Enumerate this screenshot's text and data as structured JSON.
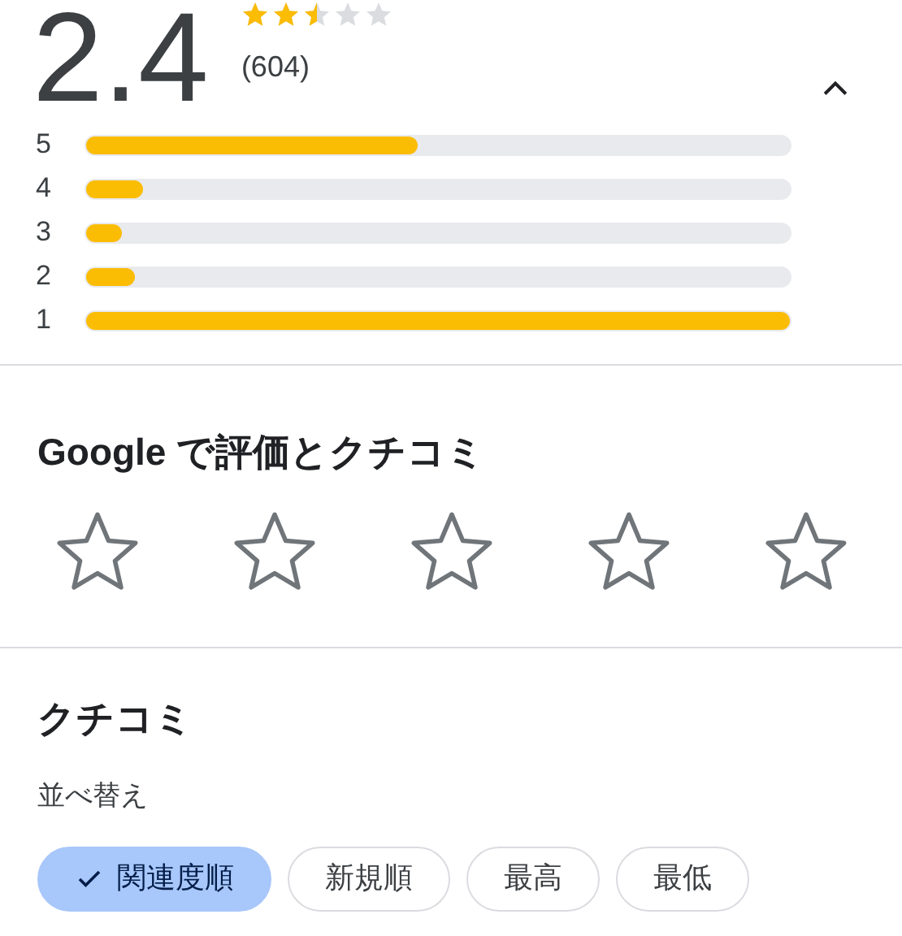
{
  "summary": {
    "score": "2.4",
    "stars": 2.5,
    "count": "(604)",
    "expanded": true
  },
  "histogram": [
    {
      "label": "5",
      "level": 0.47
    },
    {
      "label": "4",
      "level": 0.08
    },
    {
      "label": "3",
      "level": 0.05
    },
    {
      "label": "2",
      "level": 0.07
    },
    {
      "label": "1",
      "level": 1.0
    }
  ],
  "rate": {
    "title": "Google で評価とクチコミ",
    "stars": 0
  },
  "reviews": {
    "title": "クチコミ",
    "sort_label": "並べ替え",
    "chips": [
      {
        "label": "関連度順",
        "selected": true
      },
      {
        "label": "新規順",
        "selected": false
      },
      {
        "label": "最高",
        "selected": false
      },
      {
        "label": "最低",
        "selected": false
      }
    ]
  }
}
